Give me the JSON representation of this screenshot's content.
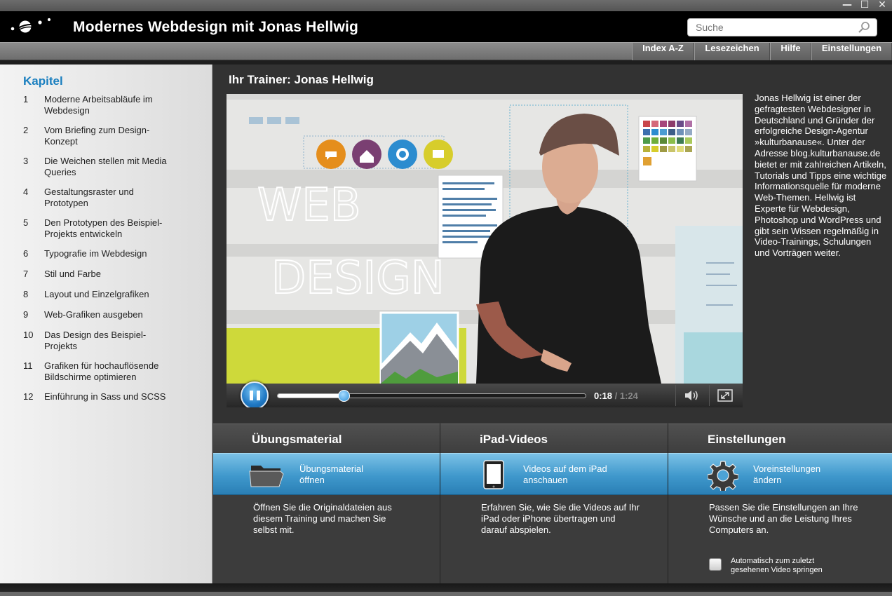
{
  "window": {
    "minimize": "—",
    "maximize": "☐",
    "close": "✕"
  },
  "header": {
    "title": "Modernes Webdesign mit Jonas Hellwig",
    "search_placeholder": "Suche"
  },
  "nav": {
    "items": [
      "Index A-Z",
      "Lesezeichen",
      "Hilfe",
      "Einstellungen"
    ]
  },
  "sidebar": {
    "title": "Kapitel",
    "chapters": [
      {
        "num": "1",
        "label": "Moderne Arbeitsabläufe im Webdesign"
      },
      {
        "num": "2",
        "label": "Vom Briefing zum Design-Konzept"
      },
      {
        "num": "3",
        "label": "Die Weichen stellen mit Media Queries"
      },
      {
        "num": "4",
        "label": "Gestaltungsraster und Prototypen"
      },
      {
        "num": "5",
        "label": "Den Prototypen des Beispiel-Projekts entwickeln"
      },
      {
        "num": "6",
        "label": "Typografie im Webdesign"
      },
      {
        "num": "7",
        "label": "Stil und Farbe"
      },
      {
        "num": "8",
        "label": "Layout und Einzelgrafiken"
      },
      {
        "num": "9",
        "label": "Web-Grafiken ausgeben"
      },
      {
        "num": "10",
        "label": "Das Design des Beispiel-Projekts"
      },
      {
        "num": "11",
        "label": "Grafiken für hochauflösende Bildschirme optimieren"
      },
      {
        "num": "12",
        "label": "Einführung in Sass und SCSS"
      }
    ]
  },
  "main": {
    "trainer_title": "Ihr Trainer: Jonas Hellwig",
    "bio": "Jonas Hellwig ist einer der gefragtesten Webdesigner in Deutschland und Gründer der erfolgreiche Design-Agentur »kulturbanause«. Unter der Adresse blog.kulturbanause.de bietet er mit zahlreichen Artikeln, Tutorials und Tipps eine wichtige Informationsquelle für moderne Web-Themen. Hellwig ist Experte für Webdesign, Photoshop und WordPress  und gibt sein Wissen regelmäßig in Video-Trainings, Schulungen und Vorträgen weiter."
  },
  "player": {
    "current_time": "0:18",
    "separator": " / ",
    "total_time": "1:24",
    "progress": 0.214,
    "video_text_web": "WEB",
    "video_text_design": "DESIGN"
  },
  "bottom": {
    "columns": [
      {
        "header": "Übungsmaterial",
        "button_label": "Übungsmaterial öffnen",
        "icon": "folder-icon",
        "description": "Öffnen Sie die Originaldateien aus diesem Training und machen Sie selbst mit."
      },
      {
        "header": "iPad-Videos",
        "button_label": "Videos auf dem iPad anschauen",
        "icon": "ipad-icon",
        "description": "Erfahren Sie, wie Sie die Videos auf Ihr iPad oder iPhone übertragen und darauf abspielen."
      },
      {
        "header": "Einstellungen",
        "button_label": "Voreinstellungen ändern",
        "icon": "gear-icon",
        "description": "Passen Sie die Einstellungen an Ihre Wünsche und an die Leistung Ihres Computers an."
      }
    ],
    "checkbox_label": "Automatisch zum zuletzt gesehenen Video springen",
    "checkbox_checked": false
  },
  "colors": {
    "accent": "#1a7fbf",
    "button_blue": "#3f98cc",
    "header_bg": "#000000",
    "panel_bg": "#323232"
  }
}
